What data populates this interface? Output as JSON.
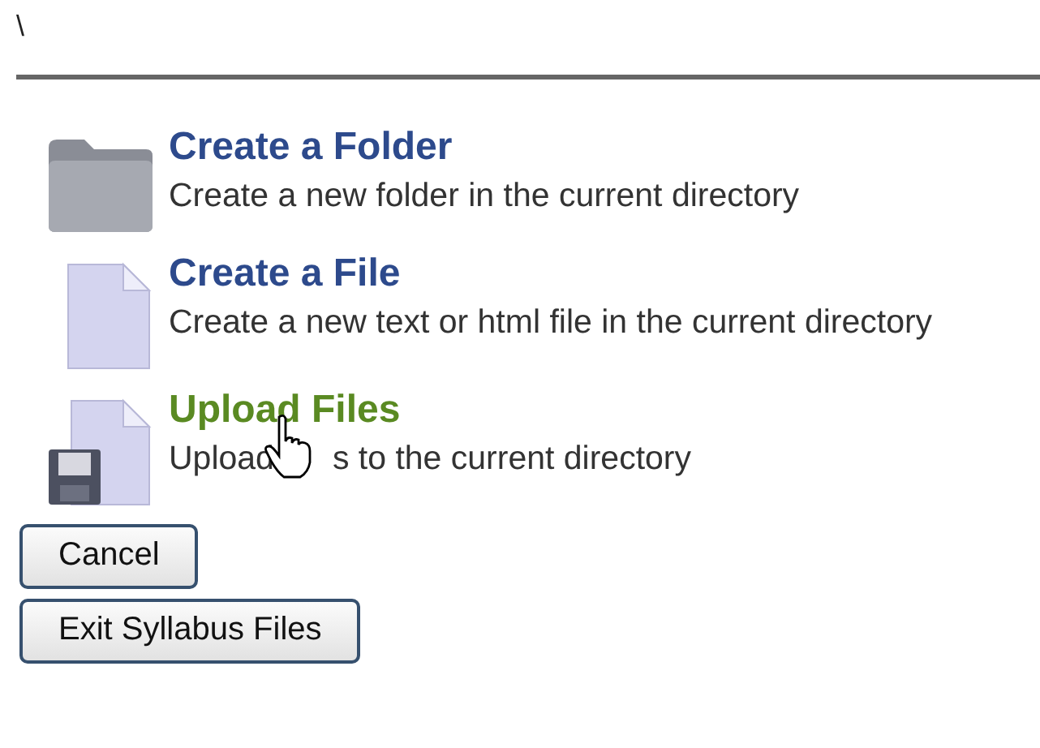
{
  "path": "\\",
  "actions": [
    {
      "kind": "folder",
      "title": "Create a Folder",
      "hovered": false,
      "description": [
        "Create a new folder in the current directory"
      ]
    },
    {
      "kind": "file",
      "title": "Create a File",
      "hovered": false,
      "description": [
        "Create a new text or html file in the current directory"
      ]
    },
    {
      "kind": "upload",
      "title": "Upload Files",
      "hovered": true,
      "description": [
        "Upload",
        "s to the current directory"
      ]
    }
  ],
  "buttons": [
    "Cancel",
    "Exit Syllabus Files"
  ]
}
